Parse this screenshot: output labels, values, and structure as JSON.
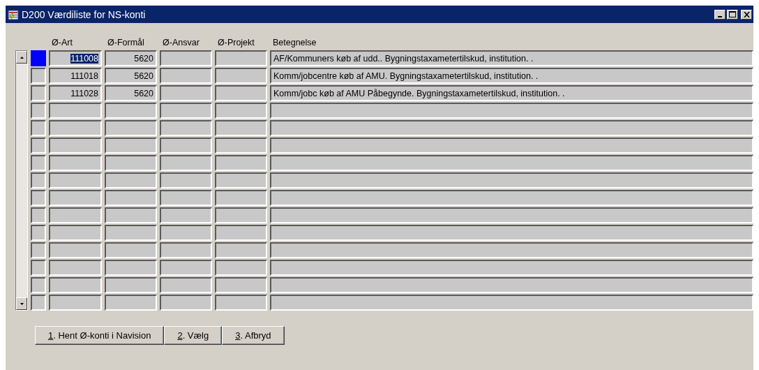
{
  "window": {
    "title": "D200 Værdiliste for NS-konti"
  },
  "table": {
    "columns": [
      "Ø-Art",
      "Ø-Formål",
      "Ø-Ansvar",
      "Ø-Projekt",
      "Betegnelse"
    ],
    "rows": [
      {
        "selected": true,
        "cells": [
          "111008",
          "5620",
          "",
          "",
          "AF/Kommuners køb af udd.. Bygningstaxametertilskud, institution. ."
        ]
      },
      {
        "selected": false,
        "cells": [
          "111018",
          "5620",
          "",
          "",
          "Komm/jobcentre køb af AMU. Bygningstaxametertilskud, institution. ."
        ]
      },
      {
        "selected": false,
        "cells": [
          "111028",
          "5620",
          "",
          "",
          "Komm/jobc køb af AMU Påbegynde. Bygningstaxametertilskud, institution. ."
        ]
      }
    ]
  },
  "buttons": [
    {
      "mnemonic": "1",
      "label": ". Hent Ø-konti i Navision"
    },
    {
      "mnemonic": "2",
      "label": ". Vælg"
    },
    {
      "mnemonic": "3",
      "label": ". Afbryd"
    }
  ]
}
